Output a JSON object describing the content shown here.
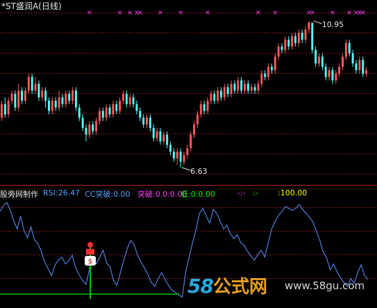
{
  "header": {
    "title": "*ST盛润A(日线)"
  },
  "indicator_bar": {
    "name": "股旁网制作",
    "rsi": "RSI:26.47",
    "cc": "CC突破:0.00",
    "tupo": "突破:0.0:0.00",
    "di": "低:0:0.00",
    "dash1": "-:-",
    "dash2": ":-",
    "hundred": ":100.00"
  },
  "colors": {
    "up": "#ff5a5a",
    "down": "#54ffff",
    "grid": "#8a1a1a",
    "rsi_line": "#4f7fe0",
    "ma_line": "#00c000",
    "cross": "#ff40ff",
    "label_white": "#e8e8e8",
    "rsi_text": "#5aa0ff",
    "pink_text": "#ff40ff",
    "green_text": "#00ff00",
    "yellow_text": "#ffff00"
  },
  "chart_data": [
    {
      "type": "candlestick",
      "title": "*ST盛润A(日线)",
      "ylim": [
        6.2,
        11.2
      ],
      "annotations": [
        {
          "label": "10.95",
          "value": 10.95,
          "index": 92
        },
        {
          "label": "6.63",
          "value": 6.63,
          "index": 53
        }
      ],
      "signal_markers": {
        "symbol": "×",
        "indices": [
          26,
          35,
          38,
          40,
          41,
          47,
          53,
          61,
          76,
          81,
          91,
          92,
          98,
          103,
          105,
          106,
          107
        ]
      },
      "candles": [
        [
          8.1,
          8.5,
          8.6,
          8.0
        ],
        [
          8.5,
          8.2,
          8.7,
          8.1
        ],
        [
          8.2,
          8.6,
          8.7,
          8.1
        ],
        [
          8.6,
          8.8,
          8.9,
          8.5
        ],
        [
          8.8,
          8.4,
          8.9,
          8.3
        ],
        [
          8.4,
          8.9,
          9.1,
          8.3
        ],
        [
          8.9,
          8.6,
          9.0,
          8.5
        ],
        [
          8.6,
          8.9,
          9.0,
          8.5
        ],
        [
          8.9,
          9.3,
          9.4,
          8.8
        ],
        [
          9.3,
          8.9,
          9.4,
          8.8
        ],
        [
          8.9,
          9.1,
          9.3,
          8.8
        ],
        [
          9.1,
          8.7,
          9.2,
          8.6
        ],
        [
          8.7,
          8.9,
          9.0,
          8.6
        ],
        [
          8.9,
          8.6,
          9.0,
          8.4
        ],
        [
          8.6,
          8.3,
          8.7,
          8.2
        ],
        [
          8.3,
          8.6,
          8.7,
          8.2
        ],
        [
          8.6,
          8.4,
          8.7,
          8.3
        ],
        [
          8.4,
          8.7,
          8.9,
          8.3
        ],
        [
          8.7,
          8.5,
          8.8,
          8.4
        ],
        [
          8.5,
          8.8,
          8.9,
          8.4
        ],
        [
          8.8,
          8.6,
          8.9,
          8.5
        ],
        [
          8.6,
          8.9,
          9.0,
          8.5
        ],
        [
          8.9,
          8.4,
          9.0,
          8.3
        ],
        [
          8.4,
          8.1,
          8.5,
          8.0
        ],
        [
          8.1,
          7.8,
          8.2,
          7.7
        ],
        [
          7.8,
          7.6,
          7.9,
          7.4
        ],
        [
          7.6,
          7.9,
          8.0,
          7.5
        ],
        [
          7.9,
          7.7,
          8.0,
          7.6
        ],
        [
          7.7,
          8.0,
          8.1,
          7.6
        ],
        [
          8.0,
          8.3,
          8.4,
          7.9
        ],
        [
          8.3,
          8.1,
          8.4,
          8.0
        ],
        [
          8.1,
          8.4,
          8.5,
          8.0
        ],
        [
          8.4,
          8.2,
          8.5,
          8.1
        ],
        [
          8.2,
          8.5,
          8.6,
          8.1
        ],
        [
          8.5,
          8.3,
          8.6,
          8.2
        ],
        [
          8.3,
          8.6,
          8.7,
          8.2
        ],
        [
          8.6,
          8.8,
          8.9,
          8.5
        ],
        [
          8.8,
          8.5,
          8.9,
          8.4
        ],
        [
          8.5,
          8.7,
          8.8,
          8.4
        ],
        [
          8.7,
          8.5,
          8.8,
          8.4
        ],
        [
          8.5,
          8.3,
          8.6,
          8.2
        ],
        [
          8.3,
          8.1,
          8.4,
          8.0
        ],
        [
          8.1,
          7.9,
          8.2,
          7.8
        ],
        [
          7.9,
          8.1,
          8.2,
          7.8
        ],
        [
          8.1,
          7.8,
          8.2,
          7.7
        ],
        [
          7.8,
          7.5,
          7.9,
          7.4
        ],
        [
          7.5,
          7.7,
          7.8,
          7.4
        ],
        [
          7.7,
          7.4,
          7.8,
          7.3
        ],
        [
          7.4,
          7.6,
          7.7,
          7.3
        ],
        [
          7.6,
          7.3,
          7.7,
          7.2
        ],
        [
          7.3,
          7.1,
          7.4,
          7.0
        ],
        [
          7.1,
          6.9,
          7.2,
          6.8
        ],
        [
          6.9,
          7.1,
          7.2,
          6.7
        ],
        [
          7.1,
          6.8,
          7.2,
          6.63
        ],
        [
          6.8,
          7.0,
          7.1,
          6.7
        ],
        [
          7.0,
          7.2,
          7.3,
          6.9
        ],
        [
          7.2,
          7.6,
          7.7,
          7.1
        ],
        [
          7.6,
          7.9,
          8.0,
          7.5
        ],
        [
          7.9,
          8.2,
          8.3,
          7.8
        ],
        [
          8.2,
          8.5,
          8.6,
          8.1
        ],
        [
          8.5,
          8.3,
          8.6,
          8.2
        ],
        [
          8.3,
          8.6,
          8.7,
          8.2
        ],
        [
          8.6,
          8.8,
          8.9,
          8.5
        ],
        [
          8.8,
          8.6,
          8.9,
          8.5
        ],
        [
          8.6,
          8.9,
          9.0,
          8.5
        ],
        [
          8.9,
          8.7,
          9.0,
          8.6
        ],
        [
          8.7,
          9.0,
          9.1,
          8.6
        ],
        [
          9.0,
          8.8,
          9.1,
          8.7
        ],
        [
          8.8,
          9.1,
          9.2,
          8.7
        ],
        [
          9.1,
          8.9,
          9.2,
          8.8
        ],
        [
          8.9,
          9.2,
          9.3,
          8.8
        ],
        [
          9.2,
          8.9,
          9.3,
          8.8
        ],
        [
          8.9,
          9.1,
          9.2,
          8.8
        ],
        [
          9.1,
          8.9,
          9.2,
          8.8
        ],
        [
          8.9,
          9.0,
          9.1,
          8.8
        ],
        [
          9.0,
          8.9,
          9.1,
          8.8
        ],
        [
          8.9,
          9.1,
          9.2,
          8.8
        ],
        [
          9.1,
          9.4,
          9.5,
          9.0
        ],
        [
          9.4,
          9.3,
          9.5,
          9.2
        ],
        [
          9.3,
          9.6,
          9.7,
          9.2
        ],
        [
          9.6,
          9.5,
          9.7,
          9.4
        ],
        [
          9.5,
          9.9,
          10.0,
          9.4
        ],
        [
          9.9,
          10.2,
          10.3,
          9.8
        ],
        [
          10.2,
          10.1,
          10.3,
          10.0
        ],
        [
          10.1,
          10.4,
          10.5,
          10.0
        ],
        [
          10.4,
          10.2,
          10.5,
          10.1
        ],
        [
          10.2,
          10.5,
          10.6,
          10.1
        ],
        [
          10.5,
          10.3,
          10.6,
          10.2
        ],
        [
          10.3,
          10.6,
          10.7,
          10.2
        ],
        [
          10.6,
          10.4,
          10.7,
          10.3
        ],
        [
          10.4,
          10.7,
          10.8,
          10.3
        ],
        [
          10.7,
          10.9,
          10.95,
          10.6
        ],
        [
          10.9,
          10.1,
          10.9,
          10.0
        ],
        [
          10.1,
          9.7,
          10.2,
          9.6
        ],
        [
          9.7,
          9.9,
          10.0,
          9.6
        ],
        [
          9.9,
          9.6,
          10.0,
          9.5
        ],
        [
          9.6,
          9.3,
          9.7,
          9.2
        ],
        [
          9.3,
          9.5,
          9.6,
          9.2
        ],
        [
          9.5,
          9.2,
          9.6,
          9.1
        ],
        [
          9.2,
          9.4,
          9.5,
          9.1
        ],
        [
          9.4,
          9.6,
          9.7,
          9.3
        ],
        [
          9.6,
          9.9,
          10.0,
          9.5
        ],
        [
          9.9,
          10.3,
          10.4,
          9.8
        ],
        [
          10.3,
          10.0,
          10.4,
          9.9
        ],
        [
          10.0,
          9.7,
          10.1,
          9.6
        ],
        [
          9.7,
          9.5,
          9.8,
          9.4
        ],
        [
          9.5,
          9.8,
          9.9,
          9.4
        ],
        [
          9.8,
          9.4,
          9.9,
          9.3
        ],
        [
          9.4,
          9.5,
          9.6,
          9.3
        ]
      ]
    },
    {
      "type": "line",
      "series": [
        {
          "name": "RSI",
          "values": [
            90,
            96,
            99,
            91,
            80,
            72,
            85,
            70,
            63,
            74,
            61,
            57,
            49,
            38,
            31,
            24,
            35,
            40,
            43,
            36,
            39,
            45,
            32,
            25,
            19,
            15,
            30,
            42,
            36,
            43,
            50,
            37,
            33,
            19,
            14,
            27,
            40,
            52,
            60,
            56,
            45,
            38,
            32,
            25,
            17,
            13,
            21,
            27,
            20,
            14,
            9,
            7,
            4,
            2,
            28,
            43,
            58,
            71,
            88,
            93,
            85,
            78,
            92,
            88,
            80,
            72,
            76,
            67,
            62,
            66,
            58,
            55,
            49,
            44,
            40,
            46,
            50,
            43,
            58,
            72,
            80,
            86,
            90,
            95,
            93,
            91,
            93,
            97,
            92,
            88,
            84,
            79,
            70,
            60,
            48,
            42,
            30,
            36,
            28,
            22,
            17,
            13,
            21,
            16,
            27,
            35,
            24,
            20
          ]
        },
        {
          "name": "baseline",
          "values": [
            5
          ]
        }
      ],
      "ylim": [
        0,
        100
      ]
    }
  ],
  "watermark": {
    "num": "58",
    "cn": "公式网",
    "url": "www.58gu.com"
  }
}
